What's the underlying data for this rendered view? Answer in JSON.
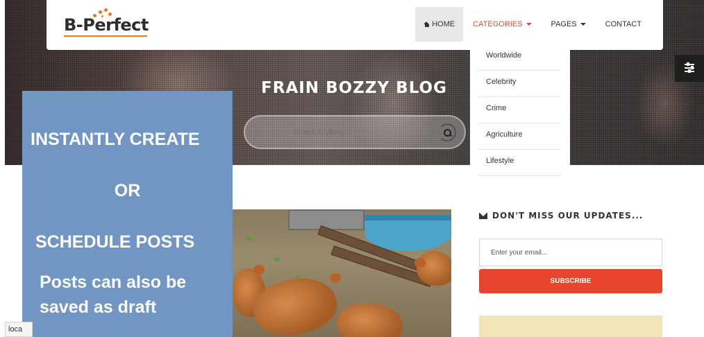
{
  "logo": {
    "text": "B-Perfect"
  },
  "nav": {
    "items": [
      {
        "label": "HOME",
        "icon": "home-icon",
        "active": true
      },
      {
        "label": "CATEGORIES",
        "dropdown": true,
        "color": "#e04a2f"
      },
      {
        "label": "PAGES",
        "dropdown": true
      },
      {
        "label": "CONTACT"
      }
    ]
  },
  "categories_menu": {
    "items": [
      "Worldwide",
      "Celebrity",
      "Crime",
      "Agriculture",
      "Lifestyle"
    ]
  },
  "hero": {
    "title": "FRAIN BOZZY BLOG",
    "search_placeholder": "Search Anything..."
  },
  "promo": {
    "line1": "INSTANTLY CREATE",
    "line2": "OR",
    "line3": "SCHEDULE POSTS",
    "line4": "Posts can also be saved as draft",
    "background": "#7196c4"
  },
  "sidebar": {
    "title": "DON'T MISS OUR UPDATES...",
    "email_placeholder": "Enter your email...",
    "subscribe_label": "SUBSCRIBE",
    "accent": "#e8452e"
  },
  "status_bar": {
    "text": "loca"
  }
}
